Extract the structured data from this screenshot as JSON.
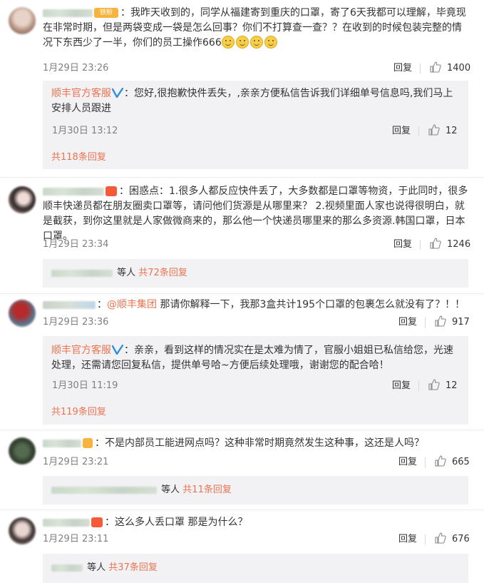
{
  "comments": [
    {
      "text_before": "：我昨天收到的，同学从福建寄到重庆的口罩，寄了6天我都可以理解，毕竟现在非常时期，但是两袋变成一袋是怎么回事？你们不打算查一查？？在收到的时候包装完整的情况下东西少了一半，你们的员工操作666",
      "badge_text": "铁粉",
      "time": "1月29日 23:26",
      "reply": "回复",
      "likes": "1400",
      "official_reply": {
        "name": "顺丰官方客服",
        "text": "：您好,很抱歉快件丢失，,亲亲方便私信告诉我们详细单号信息吗,我们马上安排人员跟进",
        "time": "1月30日 13:12",
        "reply": "回复",
        "likes": "12"
      },
      "more": "共118条回复"
    },
    {
      "text_before": "：困惑点：1.很多人都反应快件丢了，大多数都是口罩等物资，于此同时，很多顺丰快递员都在朋友圈卖口罩等，请问他们货源是从哪里来？ 2.视频里面人家也说得很明白，就是截获，到你这里就是人家做微商来的，那么他一个快递员哪里来的那么多资源.韩国口罩，日本口罩。",
      "time": "1月29日 23:34",
      "reply": "回复",
      "likes": "1246",
      "others": "等人",
      "more": "共72条回复"
    },
    {
      "mention": "@顺丰集团",
      "text_before": "：",
      "text_after": " 那请你解释一下，我那3盒共计195个口罩的包裹怎么就没有了？！！",
      "time": "1月29日 23:36",
      "reply": "回复",
      "likes": "917",
      "official_reply": {
        "name": "顺丰官方客服",
        "text": "：亲亲，看到这样的情况实在是太难为情了，官服小姐姐已私信给您，光速处理，还需请您回复私信，提供单号哈~方便后续处理哦，谢谢您的配合哈！",
        "time": "1月30日 11:19",
        "reply": "回复",
        "likes": "12"
      },
      "more": "共119条回复"
    },
    {
      "text_before": "：不是内部员工能进网点吗？这种非常时期竟然发生这种事，这还是人吗？",
      "time": "1月29日 23:21",
      "reply": "回复",
      "likes": "665",
      "others": "等人",
      "more": "共11条回复"
    },
    {
      "text_before": "：这么多人丢口罩 那是为什么？",
      "time": "1月29日 23:11",
      "reply": "回复",
      "likes": "676",
      "others": "等人",
      "more": "共37条回复"
    }
  ],
  "icons": {
    "like": "thumbs-up-icon",
    "verified": "verified-v-icon",
    "emoji": "smile-emoji-icon"
  },
  "colors": {
    "accent": "#eb7350",
    "verified": "#2f8fd8",
    "meta": "#808080",
    "subbox_bg": "#f2f2f5"
  }
}
